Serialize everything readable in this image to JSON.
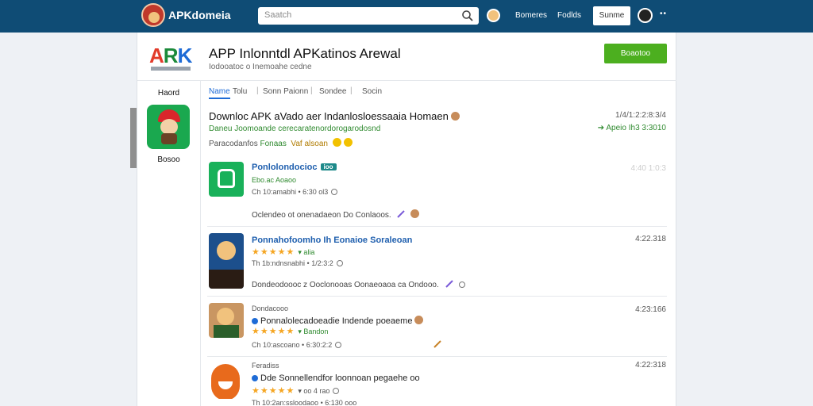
{
  "topbar": {
    "brand": "APKdomeia",
    "search_placeholder": "Saatch",
    "links": [
      "Bomeres",
      "Fodlds"
    ],
    "button": "Sunme",
    "more": "••"
  },
  "header": {
    "logo": {
      "a": "A",
      "r": "R",
      "k": "K"
    },
    "title": "APP Inlonntdl APKatinos Arewal",
    "subtitle": "Iodooatoc o Inemoahe cedne",
    "button": "Boaotoo"
  },
  "sidebar": {
    "label_top": "Haord",
    "label_bottom": "Bosoo"
  },
  "tabs": [
    {
      "label": "Name",
      "active": true
    },
    {
      "label": "Tolu",
      "active": false
    },
    {
      "label": "Sonn Paionn",
      "active": false
    },
    {
      "label": "Sondee",
      "active": false
    },
    {
      "label": "Socin",
      "active": false
    }
  ],
  "featured": {
    "title": "Downloc APK aVado aer Indanlosloessaaia Homaen",
    "subtitle": "Daneu Joomoande cerecaratenordorogarodosnd",
    "meta_prefix": "Paracodanfos",
    "meta_hl1": "Fonaas",
    "meta_hl2": "Vaf alsoan",
    "right_top": "1/4/1:2:2:8:3/4",
    "right_bottom": "➔ Apeio Ih3 3:3010"
  },
  "apps": [
    {
      "name": "Ponlolondocioc",
      "badge": "ioo",
      "sub": "Ebo.ac Aoaoo",
      "line": "Ch 10:amabhi • 6:30 ol3",
      "desc": "Oclendeo ot onenadaeon Do Conlaoos.",
      "date": "4:40 1:0:3"
    },
    {
      "name": "Ponnahofoomho Ih Eonaioe Soraleoan",
      "stars": "★★★★★",
      "stars_label": "▾ alia",
      "line": "Th 1b:ndnsnabhi • 1/2:3:2",
      "desc": "Dondeodoooc z Ooclonooas Oonaeoaoa ca Ondooo.",
      "date": "4:22.318"
    },
    {
      "pre": "Dondacooo",
      "name": "Ponnalolecadoeadie Indende poeaeme",
      "stars": "★★★★★",
      "stars_label": "▾ Bandon",
      "line": "Ch 10:ascoano • 6:30:2:2",
      "date": "4:23:166"
    },
    {
      "pre": "Feradiss",
      "name": "Dde Sonnellendfor loonnoan pegaehe oo",
      "stars": "★★★★★",
      "stars_label": "▾ oo 4 rao",
      "line": "Th 10:2an:ssloodaoo • 6:130 ooo",
      "date": "4:22:318"
    }
  ]
}
